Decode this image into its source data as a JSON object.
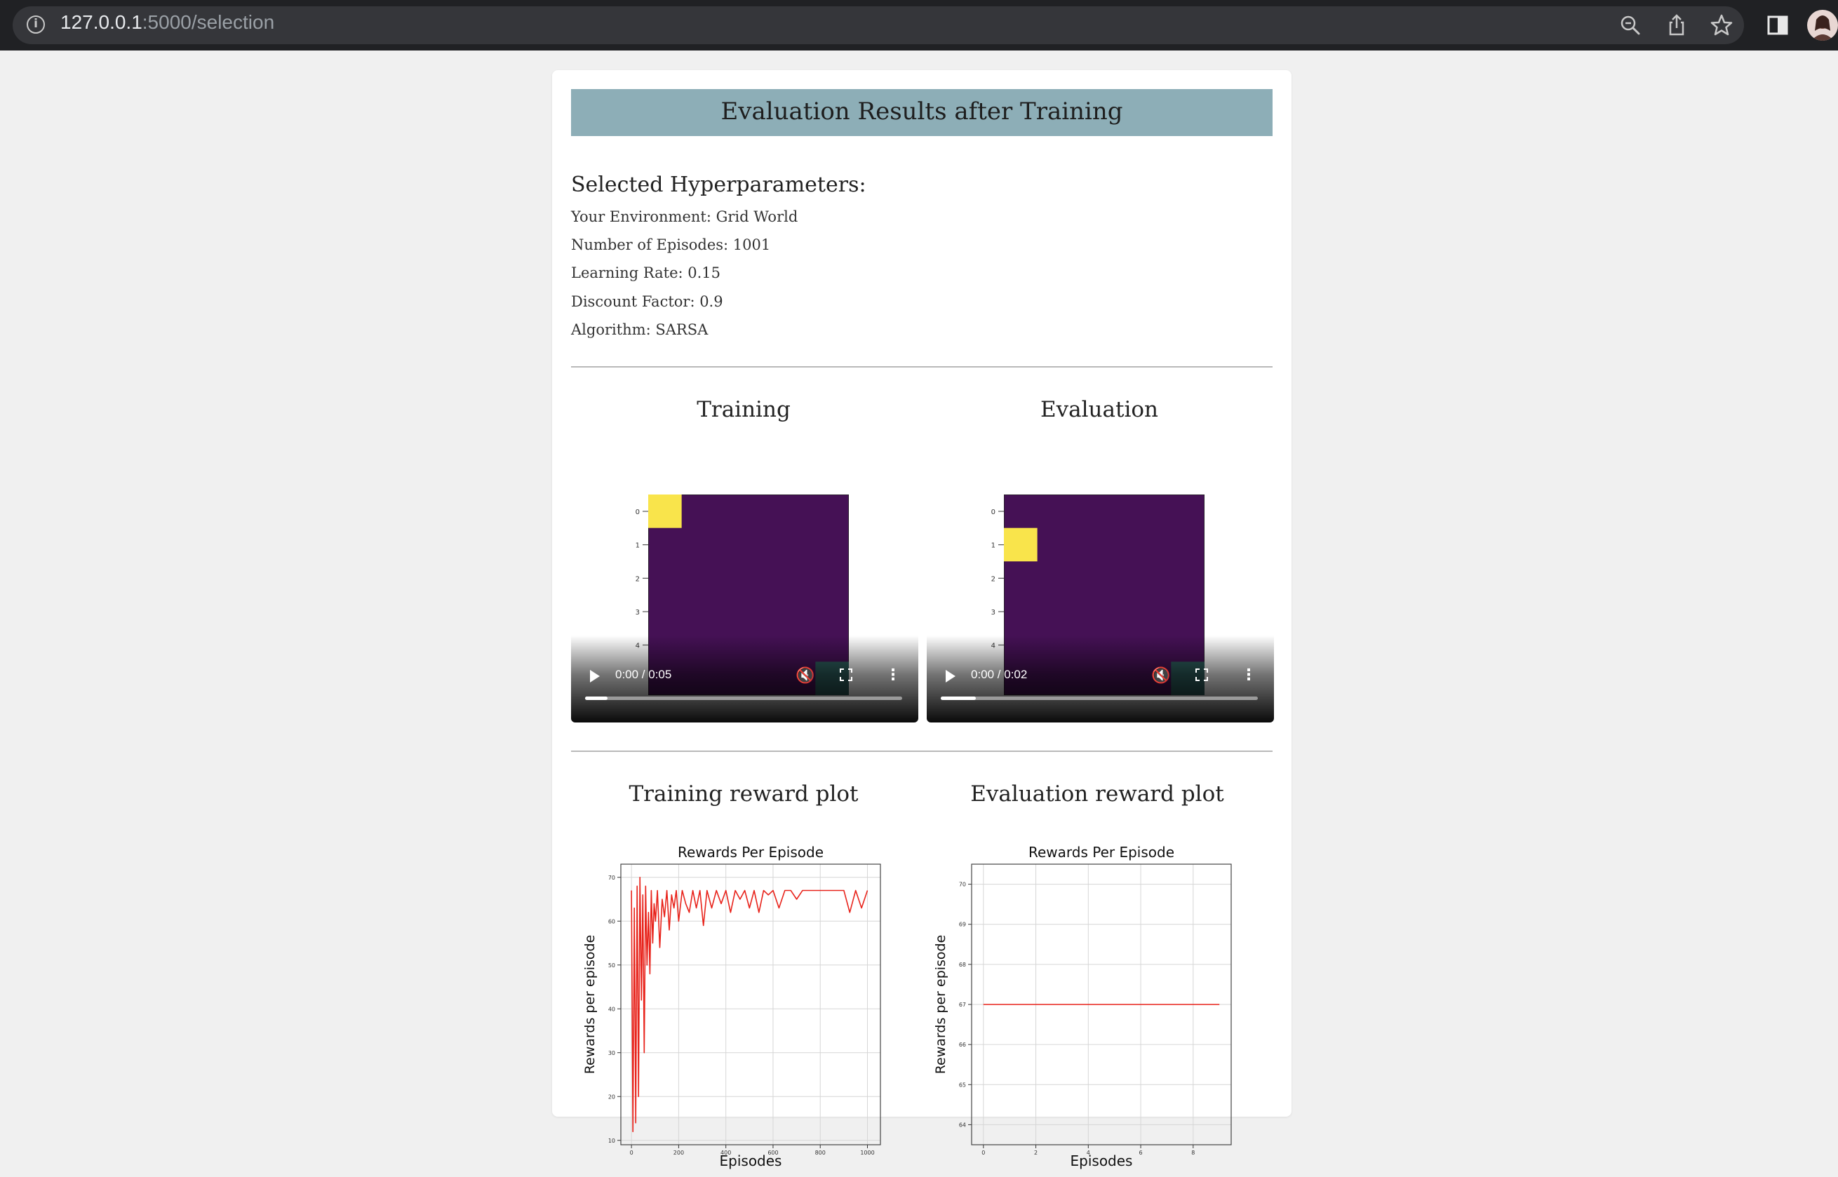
{
  "browser": {
    "url_host": "127.0.0.1",
    "url_path": ":5000/selection"
  },
  "page": {
    "title": "Evaluation Results after Training",
    "hyper_title": "Selected Hyperparameters:",
    "params": [
      "Your Environment: Grid World",
      "Number of Episodes: 1001",
      "Learning Rate: 0.15",
      "Discount Factor: 0.9",
      "Algorithm: SARSA"
    ],
    "training_title": "Training",
    "evaluation_title": "Evaluation",
    "training_plot_title": "Training reward plot",
    "evaluation_plot_title": "Evaluation reward plot"
  },
  "videos": {
    "training": {
      "time": "0:00 / 0:05",
      "progress": 0.07,
      "agent_row": 0,
      "agent_col": 0,
      "row_ticks": [
        "0",
        "1",
        "2",
        "3",
        "4"
      ]
    },
    "evaluation": {
      "time": "0:00 / 0:02",
      "progress": 0.11,
      "agent_row": 1,
      "agent_col": 0,
      "row_ticks": [
        "0",
        "1",
        "2",
        "3",
        "4"
      ]
    }
  },
  "colors": {
    "grid_bg": "#451155",
    "agent": "#f9e44b",
    "goal": "#2e5f5e",
    "banner": "#8daeb7",
    "plot_line": "#e8231b"
  },
  "chart_data": [
    {
      "type": "line",
      "title": "Rewards Per Episode",
      "xlabel": "Episodes",
      "ylabel": "Rewards per episode",
      "xlim": [
        -45,
        1055
      ],
      "ylim": [
        9,
        73
      ],
      "xticks": [
        0,
        200,
        400,
        600,
        800,
        1000
      ],
      "yticks": [
        10,
        20,
        30,
        40,
        50,
        60,
        70
      ],
      "grid": true,
      "series": [
        {
          "x": [
            0,
            6,
            12,
            18,
            24,
            30,
            36,
            42,
            48,
            54,
            60,
            66,
            72,
            78,
            84,
            90,
            96,
            102,
            110,
            120,
            130,
            140,
            150,
            160,
            170,
            180,
            190,
            200,
            215,
            230,
            245,
            260,
            275,
            290,
            305,
            320,
            340,
            360,
            380,
            400,
            420,
            440,
            460,
            480,
            500,
            520,
            540,
            560,
            580,
            600,
            625,
            650,
            675,
            700,
            725,
            750,
            775,
            800,
            825,
            850,
            875,
            900,
            925,
            950,
            975,
            1000
          ],
          "y": [
            67,
            12,
            63,
            14,
            68,
            20,
            70,
            42,
            66,
            30,
            68,
            50,
            62,
            48,
            67,
            55,
            64,
            60,
            67,
            54,
            65,
            61,
            67,
            58,
            66,
            63,
            67,
            60,
            67,
            64,
            62,
            67,
            63,
            67,
            59,
            67,
            63,
            67,
            64,
            67,
            62,
            67,
            65,
            67,
            63,
            67,
            62,
            67,
            66,
            67,
            63,
            67,
            67,
            65,
            67,
            67,
            67,
            67,
            67,
            67,
            67,
            67,
            62,
            67,
            63,
            67
          ]
        }
      ]
    },
    {
      "type": "line",
      "title": "Rewards Per Episode",
      "xlabel": "Episodes",
      "ylabel": "Rewards per episode",
      "xlim": [
        -0.45,
        9.45
      ],
      "ylim": [
        63.5,
        70.5
      ],
      "xticks": [
        0,
        2,
        4,
        6,
        8
      ],
      "yticks": [
        64,
        65,
        66,
        67,
        68,
        69,
        70
      ],
      "grid": true,
      "series": [
        {
          "x": [
            0,
            1,
            2,
            3,
            4,
            5,
            6,
            7,
            8,
            9
          ],
          "y": [
            67,
            67,
            67,
            67,
            67,
            67,
            67,
            67,
            67,
            67
          ]
        }
      ]
    }
  ]
}
